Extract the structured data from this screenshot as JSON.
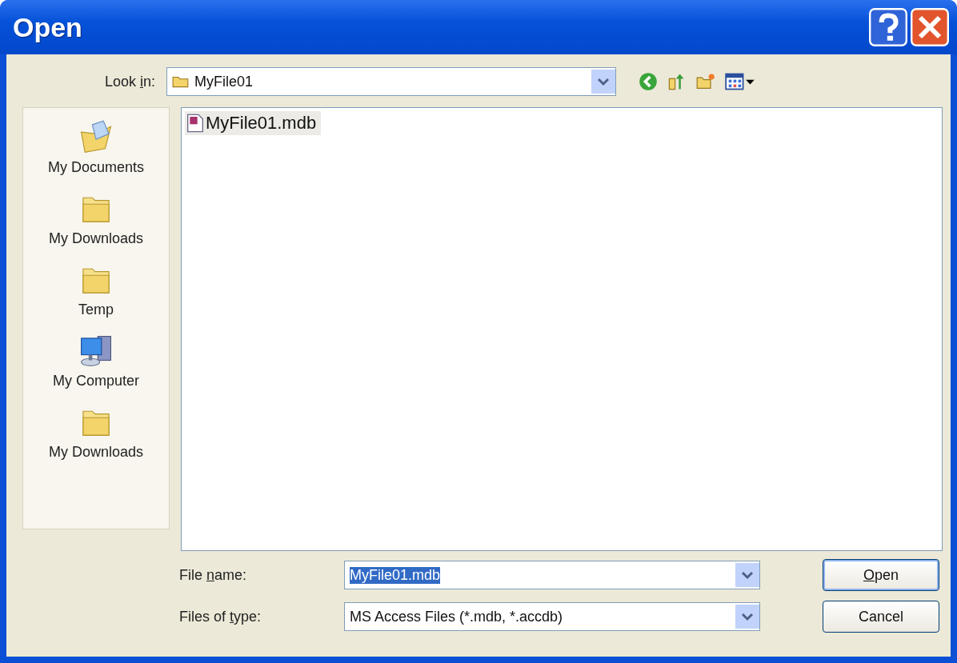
{
  "window": {
    "title": "Open"
  },
  "look_in": {
    "label": {
      "before": "Look ",
      "key": "i",
      "after": "n:"
    },
    "value": "MyFile01"
  },
  "places": [
    {
      "kind": "documents",
      "label": "My Documents"
    },
    {
      "kind": "folder",
      "label": "My Downloads"
    },
    {
      "kind": "folder",
      "label": "Temp"
    },
    {
      "kind": "computer",
      "label": "My Computer"
    },
    {
      "kind": "folder",
      "label": "My Downloads"
    }
  ],
  "files": [
    {
      "name": "MyFile01.mdb",
      "selected": true
    }
  ],
  "file_name": {
    "label": {
      "before": "File ",
      "key": "n",
      "after": "ame:"
    },
    "value": "MyFile01.mdb",
    "value_selected": true
  },
  "file_type": {
    "label": {
      "before": "Files of ",
      "key": "t",
      "after": "ype:"
    },
    "value": "MS Access Files (*.mdb, *.accdb)"
  },
  "buttons": [
    {
      "label": {
        "key": "O",
        "after": "pen"
      },
      "default": true
    },
    {
      "label": {
        "before": "Cancel"
      },
      "default": false
    }
  ]
}
